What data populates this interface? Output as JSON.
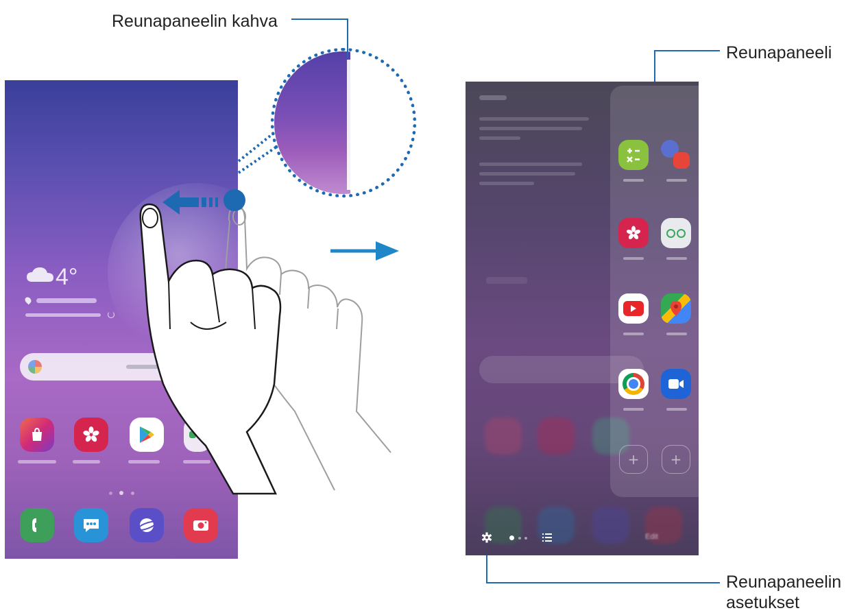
{
  "callouts": {
    "handle": "Reunapaneelin kahva",
    "panel": "Reunapaneeli",
    "settings_line1": "Reunapaneelin",
    "settings_line2": "asetukset"
  },
  "left_screen": {
    "temperature": "4°",
    "home_apps": [
      "store-icon",
      "gallery-icon",
      "play-store-icon",
      "folder-icon"
    ],
    "dock_apps": [
      "phone-icon",
      "messages-icon",
      "internet-icon",
      "camera-icon"
    ]
  },
  "right_screen": {
    "panel_apps": [
      "calculator-icon",
      "internet-icon",
      "gallery-icon",
      "folder-icon",
      "youtube-icon",
      "maps-icon",
      "chrome-icon",
      "duo-icon"
    ],
    "add_slots": [
      "+",
      "+"
    ],
    "edit_label": "Edit"
  },
  "colors": {
    "accent": "#1d6ab3",
    "arrow": "#1f86c8"
  }
}
